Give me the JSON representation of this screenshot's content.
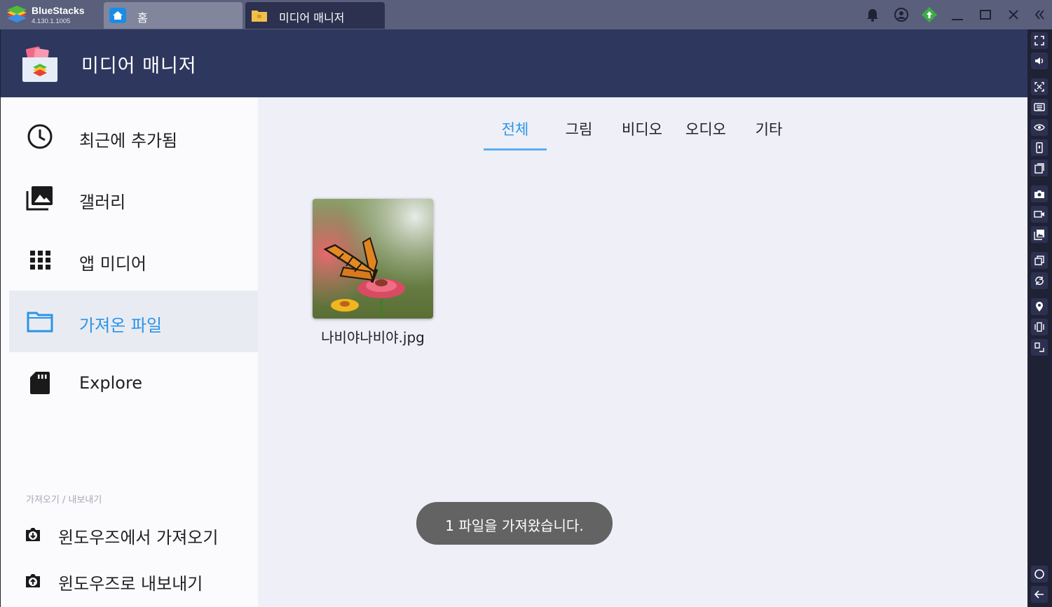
{
  "titlebar": {
    "brand_name": "BlueStacks",
    "brand_version": "4.130.1.1005",
    "tabs": [
      {
        "label": "홈",
        "icon": "home-icon"
      },
      {
        "label": "미디어 매니저",
        "icon": "folder-icon"
      }
    ],
    "controls": [
      "bell-icon",
      "account-icon",
      "gear-update-icon",
      "minimize-icon",
      "maximize-icon",
      "close-icon",
      "collapse-sidebar-icon"
    ]
  },
  "app": {
    "title": "미디어 매니저",
    "nav": {
      "items": [
        {
          "label": "최근에 추가됨",
          "icon": "clock-icon",
          "active": false
        },
        {
          "label": "갤러리",
          "icon": "gallery-icon",
          "active": false
        },
        {
          "label": "앱 미디어",
          "icon": "grid-icon",
          "active": false
        },
        {
          "label": "가져온 파일",
          "icon": "folder-icon",
          "active": true
        },
        {
          "label": "Explore",
          "icon": "sd-card-icon",
          "active": false
        }
      ],
      "section_label": "가져오기 / 내보내기",
      "actions": [
        {
          "label": "윈도우즈에서 가져오기",
          "icon": "import-icon"
        },
        {
          "label": "윈도우즈로 내보내기",
          "icon": "export-icon"
        }
      ]
    },
    "content": {
      "tabs": [
        "전체",
        "그림",
        "비디오",
        "오디오",
        "기타"
      ],
      "active_tab": "전체",
      "files": [
        {
          "name": "나비야나비야.jpg",
          "type": "image"
        }
      ],
      "toast": "1 파일을 가져왔습니다."
    }
  },
  "right_toolbar": {
    "buttons": [
      "fullscreen-icon",
      "volume-icon",
      "screen-expand-icon",
      "keyboard-icon",
      "eye-icon",
      "phone-portrait-icon",
      "copy-icon",
      "camera-icon",
      "video-record-icon",
      "media-folder-icon",
      "multi-instance-icon",
      "rotate-icon",
      "location-icon",
      "shake-icon",
      "resize-icon",
      "home-circle-icon",
      "back-arrow-icon"
    ]
  },
  "colors": {
    "titlebar": "#5a5f7c",
    "appbar": "#2e375e",
    "accent": "#2a95e6",
    "toast": "#636363"
  }
}
